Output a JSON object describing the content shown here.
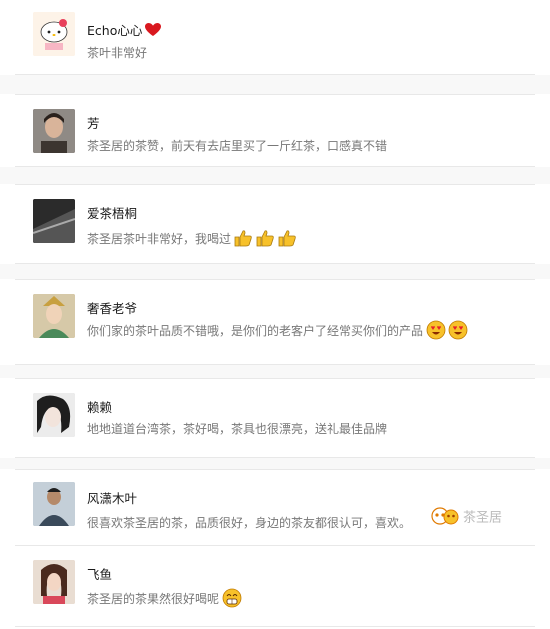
{
  "comments": [
    {
      "name": "Echo心心",
      "text": "茶叶非常好"
    },
    {
      "name": "芳",
      "text": "茶圣居的茶赞，前天有去店里买了一斤红茶，口感真不错"
    },
    {
      "name": "爱茶梧桐",
      "text": "茶圣居茶叶非常好，我喝过"
    },
    {
      "name": "奢香老爷",
      "text": "你们家的茶叶品质不错哦，是你们的老客户了经常买你们的产品"
    },
    {
      "name": "赖赖",
      "text": "地地道道台湾茶，茶好喝，茶具也很漂亮，送礼最佳品牌"
    },
    {
      "name": "风潇木叶",
      "text": "很喜欢茶圣居的茶，品质很好，身边的茶友都很认可，喜欢。"
    },
    {
      "name": "飞鱼",
      "text": "茶圣居的茶果然很好喝呢"
    }
  ],
  "watermark": "茶圣居",
  "icons": {
    "heart": "heart-icon",
    "thumbs_up": "thumbs-up-emoji",
    "heart_eyes": "heart-eyes-emoji",
    "grin": "grin-emoji"
  },
  "colors": {
    "heart": "#d9181f",
    "emoji_yellow": "#f7c12a",
    "name": "#1a1a1a",
    "text": "#777777"
  }
}
